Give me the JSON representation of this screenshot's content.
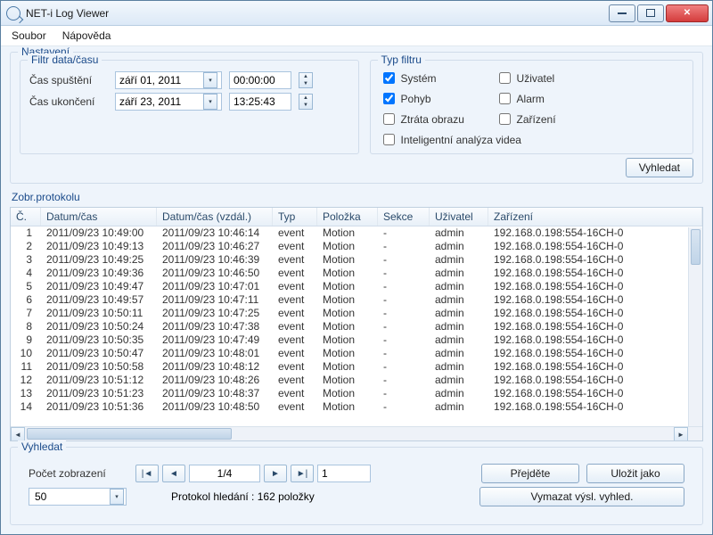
{
  "window": {
    "title": "NET-i Log Viewer"
  },
  "menu": {
    "file": "Soubor",
    "help": "Nápověda"
  },
  "settings": {
    "legend": "Nastavení",
    "dateFilter": {
      "legend": "Filtr data/času",
      "startLabel": "Čas spuštění",
      "endLabel": "Čas ukončení",
      "startDate": "září     01, 2011",
      "startTime": "00:00:00",
      "endDate": "září     23, 2011",
      "endTime": "13:25:43"
    },
    "typeFilter": {
      "legend": "Typ filtru",
      "options": {
        "system": {
          "label": "Systém",
          "checked": true
        },
        "user": {
          "label": "Uživatel",
          "checked": false
        },
        "motion": {
          "label": "Pohyb",
          "checked": true
        },
        "alarm": {
          "label": "Alarm",
          "checked": false
        },
        "vloss": {
          "label": "Ztráta obrazu",
          "checked": false
        },
        "device": {
          "label": "Zařízení",
          "checked": false
        },
        "iva": {
          "label": "Inteligentní analýza videa",
          "checked": false
        }
      }
    },
    "searchBtn": "Vyhledat"
  },
  "log": {
    "legend": "Zobr.protokolu",
    "headers": [
      "Č.",
      "Datum/čas",
      "Datum/čas (vzdál.)",
      "Typ",
      "Položka",
      "Sekce",
      "Uživatel",
      "Zařízení"
    ],
    "rows": [
      [
        "1",
        "2011/09/23 10:49:00",
        "2011/09/23 10:46:14",
        "event",
        "Motion",
        "-",
        "admin",
        "192.168.0.198:554-16CH-0"
      ],
      [
        "2",
        "2011/09/23 10:49:13",
        "2011/09/23 10:46:27",
        "event",
        "Motion",
        "-",
        "admin",
        "192.168.0.198:554-16CH-0"
      ],
      [
        "3",
        "2011/09/23 10:49:25",
        "2011/09/23 10:46:39",
        "event",
        "Motion",
        "-",
        "admin",
        "192.168.0.198:554-16CH-0"
      ],
      [
        "4",
        "2011/09/23 10:49:36",
        "2011/09/23 10:46:50",
        "event",
        "Motion",
        "-",
        "admin",
        "192.168.0.198:554-16CH-0"
      ],
      [
        "5",
        "2011/09/23 10:49:47",
        "2011/09/23 10:47:01",
        "event",
        "Motion",
        "-",
        "admin",
        "192.168.0.198:554-16CH-0"
      ],
      [
        "6",
        "2011/09/23 10:49:57",
        "2011/09/23 10:47:11",
        "event",
        "Motion",
        "-",
        "admin",
        "192.168.0.198:554-16CH-0"
      ],
      [
        "7",
        "2011/09/23 10:50:11",
        "2011/09/23 10:47:25",
        "event",
        "Motion",
        "-",
        "admin",
        "192.168.0.198:554-16CH-0"
      ],
      [
        "8",
        "2011/09/23 10:50:24",
        "2011/09/23 10:47:38",
        "event",
        "Motion",
        "-",
        "admin",
        "192.168.0.198:554-16CH-0"
      ],
      [
        "9",
        "2011/09/23 10:50:35",
        "2011/09/23 10:47:49",
        "event",
        "Motion",
        "-",
        "admin",
        "192.168.0.198:554-16CH-0"
      ],
      [
        "10",
        "2011/09/23 10:50:47",
        "2011/09/23 10:48:01",
        "event",
        "Motion",
        "-",
        "admin",
        "192.168.0.198:554-16CH-0"
      ],
      [
        "11",
        "2011/09/23 10:50:58",
        "2011/09/23 10:48:12",
        "event",
        "Motion",
        "-",
        "admin",
        "192.168.0.198:554-16CH-0"
      ],
      [
        "12",
        "2011/09/23 10:51:12",
        "2011/09/23 10:48:26",
        "event",
        "Motion",
        "-",
        "admin",
        "192.168.0.198:554-16CH-0"
      ],
      [
        "13",
        "2011/09/23 10:51:23",
        "2011/09/23 10:48:37",
        "event",
        "Motion",
        "-",
        "admin",
        "192.168.0.198:554-16CH-0"
      ],
      [
        "14",
        "2011/09/23 10:51:36",
        "2011/09/23 10:48:50",
        "event",
        "Motion",
        "-",
        "admin",
        "192.168.0.198:554-16CH-0"
      ]
    ]
  },
  "footer": {
    "legend": "Vyhledat",
    "viewCountLabel": "Počet zobrazení",
    "viewCountValue": "50",
    "pageDisplay": "1/4",
    "gotoValue": "1",
    "gotoBtn": "Přejděte",
    "saveBtn": "Uložit jako",
    "clearBtn": "Vymazat výsl. vyhled.",
    "statusText": "Protokol hledání : 162 položky"
  }
}
